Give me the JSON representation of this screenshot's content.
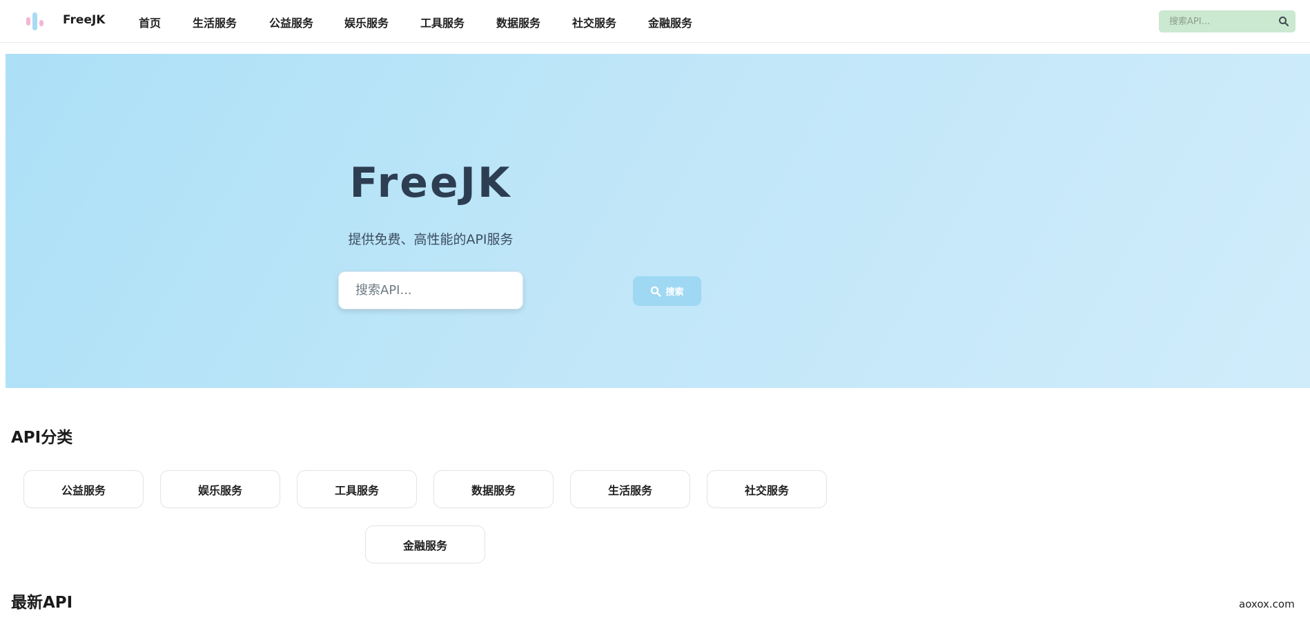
{
  "navbar": {
    "logo_text": "FreeJK",
    "items": [
      {
        "label": "首页"
      },
      {
        "label": "生活服务"
      },
      {
        "label": "公益服务"
      },
      {
        "label": "娱乐服务"
      },
      {
        "label": "工具服务"
      },
      {
        "label": "数据服务"
      },
      {
        "label": "社交服务"
      },
      {
        "label": "金融服务"
      }
    ],
    "search": {
      "placeholder": "搜索API...",
      "value": "",
      "icon": "search-icon"
    }
  },
  "hero": {
    "title": "FreeJK",
    "subtitle": "提供免费、高性能的API服务",
    "search_placeholder": "搜索API...",
    "search_value": "",
    "search_button_label": "搜索",
    "search_button_icon": "search-icon"
  },
  "categories": {
    "title": "API分类",
    "items": [
      {
        "label": "公益服务"
      },
      {
        "label": "娱乐服务"
      },
      {
        "label": "工具服务"
      },
      {
        "label": "数据服务"
      },
      {
        "label": "生活服务"
      },
      {
        "label": "社交服务"
      },
      {
        "label": "金融服务"
      }
    ]
  },
  "latest": {
    "title": "最新API"
  },
  "watermark": "aoxox.com",
  "colors": {
    "hero_bg": "#b6e2f7",
    "nav_search_bg": "#cbe8d0",
    "search_button": "#9fd8f3",
    "title_text": "#2d3e52"
  }
}
